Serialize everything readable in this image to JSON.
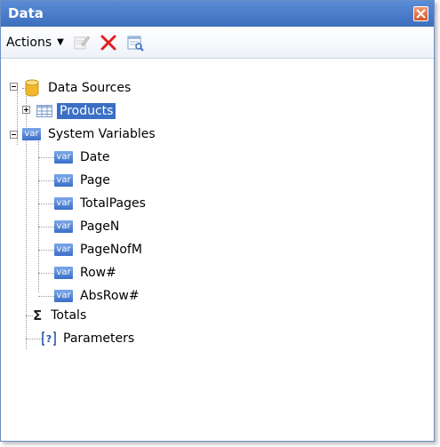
{
  "window": {
    "title": "Data"
  },
  "toolbar": {
    "actions_label": "Actions",
    "icons": [
      "edit-icon",
      "delete-icon",
      "view-icon"
    ]
  },
  "tree": {
    "data_sources": "Data Sources",
    "products": "Products",
    "system_variables": "System Variables",
    "var_badge": "var",
    "variables": [
      "Date",
      "Page",
      "TotalPages",
      "PageN",
      "PageNofM",
      "Row#",
      "AbsRow#"
    ],
    "totals": "Totals",
    "parameters": "Parameters"
  },
  "colors": {
    "title_bar": "#4a7fcf",
    "selection": "#3a6fc4",
    "close": "#d4552a"
  }
}
